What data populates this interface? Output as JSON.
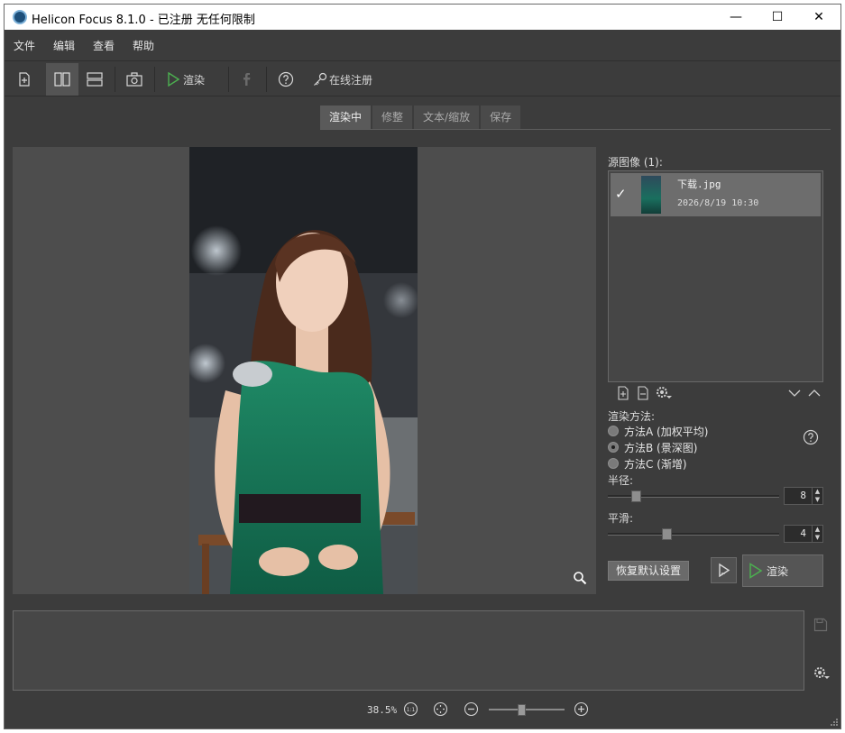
{
  "window": {
    "title": "Helicon Focus 8.1.0 - 已注册  无任何限制",
    "minimize_glyph": "—",
    "maximize_glyph": "☐",
    "close_glyph": "✕"
  },
  "menu": [
    "文件",
    "编辑",
    "查看",
    "帮助"
  ],
  "toolbar": {
    "render_label": "渲染",
    "register_label": "在线注册",
    "icons": [
      "add-file-icon",
      "layout-vertical-icon",
      "layout-horizontal-icon",
      "camera-icon",
      "play-icon",
      "facebook-icon",
      "help-icon",
      "key-icon"
    ]
  },
  "tabs": [
    {
      "label": "渲染中",
      "active": true
    },
    {
      "label": "修整",
      "active": false
    },
    {
      "label": "文本/缩放",
      "active": false
    },
    {
      "label": "保存",
      "active": false
    }
  ],
  "sources": {
    "label": "源图像 (1):",
    "items": [
      {
        "name": "下载.jpg",
        "date": "2026/8/19 10:30",
        "checked": true
      }
    ]
  },
  "method": {
    "title": "渲染方法:",
    "options": [
      {
        "label": "方法A (加权平均)",
        "checked": false
      },
      {
        "label": "方法B (景深图)",
        "checked": true
      },
      {
        "label": "方法C (渐增)",
        "checked": false
      }
    ]
  },
  "params": {
    "radius": {
      "label": "半径:",
      "value": "8"
    },
    "smoothing": {
      "label": "平滑:",
      "value": "4"
    }
  },
  "buttons": {
    "reset": "恢复默认设置",
    "render": "渲染"
  },
  "status": {
    "zoom": "38.5%"
  },
  "colors": {
    "accent_green": "#4caf50",
    "background": "#3c3c3c",
    "panel": "#4d4d4d"
  }
}
